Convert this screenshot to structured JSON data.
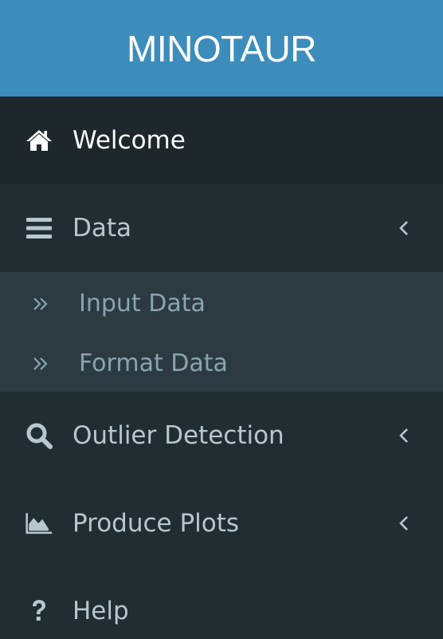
{
  "app": {
    "title": "MINOTAUR"
  },
  "sidebar": {
    "items": [
      {
        "label": "Welcome",
        "icon": "home-icon",
        "active": true
      },
      {
        "label": "Data",
        "icon": "bars-icon",
        "expanded": true,
        "children": [
          {
            "label": "Input Data",
            "icon": "double-chevron-right-icon"
          },
          {
            "label": "Format Data",
            "icon": "double-chevron-right-icon"
          }
        ]
      },
      {
        "label": "Outlier Detection",
        "icon": "search-icon"
      },
      {
        "label": "Produce Plots",
        "icon": "area-chart-icon"
      },
      {
        "label": "Help",
        "icon": "question-icon"
      }
    ]
  },
  "colors": {
    "header_bg": "#3c8dbc",
    "sidebar_bg": "#222d32",
    "active_bg": "#1e282c",
    "submenu_bg": "#2c3b41",
    "text": "#b8c7ce",
    "subtext": "#8aa4af",
    "active_text": "#ffffff"
  }
}
